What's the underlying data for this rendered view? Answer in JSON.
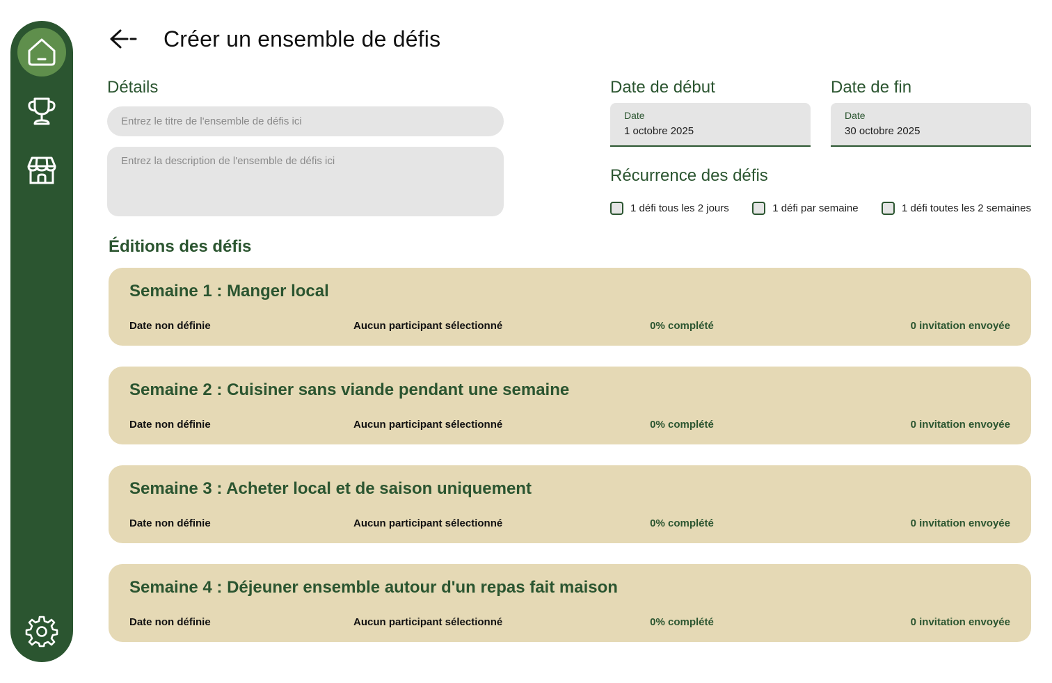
{
  "sidebar": {
    "items": [
      {
        "icon": "home-icon",
        "active": true
      },
      {
        "icon": "trophy-icon",
        "active": false
      },
      {
        "icon": "store-icon",
        "active": false
      }
    ],
    "settings_icon": "gear-icon"
  },
  "header": {
    "back_icon": "arrow-left-icon",
    "title": "Créer un ensemble de défis"
  },
  "details": {
    "label": "Détails",
    "title_placeholder": "Entrez le titre de l'ensemble de défis ici",
    "description_placeholder": "Entrez la description de l'ensemble de défis ici"
  },
  "start_date": {
    "label": "Date de début",
    "field_label": "Date",
    "value": "1 octobre 2025"
  },
  "end_date": {
    "label": "Date de fin",
    "field_label": "Date",
    "value": "30 octobre 2025"
  },
  "recurrence": {
    "label": "Récurrence des défis",
    "options": [
      {
        "label": "1 défi tous les 2 jours",
        "checked": false
      },
      {
        "label": "1 défi par semaine",
        "checked": false
      },
      {
        "label": "1 défi toutes les 2 semaines",
        "checked": false
      }
    ]
  },
  "editions": {
    "label": "Éditions des défis",
    "cards": [
      {
        "title": "Semaine 1 : Manger local",
        "date": "Date non définie",
        "participants": "Aucun participant sélectionné",
        "progress": "0% complété",
        "invitations": "0 invitation envoyée"
      },
      {
        "title": "Semaine 2 : Cuisiner sans viande pendant une semaine",
        "date": "Date non définie",
        "participants": "Aucun participant sélectionné",
        "progress": "0% complété",
        "invitations": "0 invitation envoyée"
      },
      {
        "title": "Semaine 3 : Acheter local et de saison uniquement",
        "date": "Date non définie",
        "participants": "Aucun participant sélectionné",
        "progress": "0% complété",
        "invitations": "0 invitation envoyée"
      },
      {
        "title": "Semaine 4 :  Déjeuner ensemble autour d'un repas fait maison",
        "date": "Date non définie",
        "participants": "Aucun participant sélectionné",
        "progress": "0% complété",
        "invitations": "0 invitation envoyée"
      }
    ]
  },
  "colors": {
    "primary": "#2b5530",
    "active_nav": "#5f8f4c",
    "card_bg": "#e5d9b5",
    "input_bg": "#e5e5e5"
  }
}
